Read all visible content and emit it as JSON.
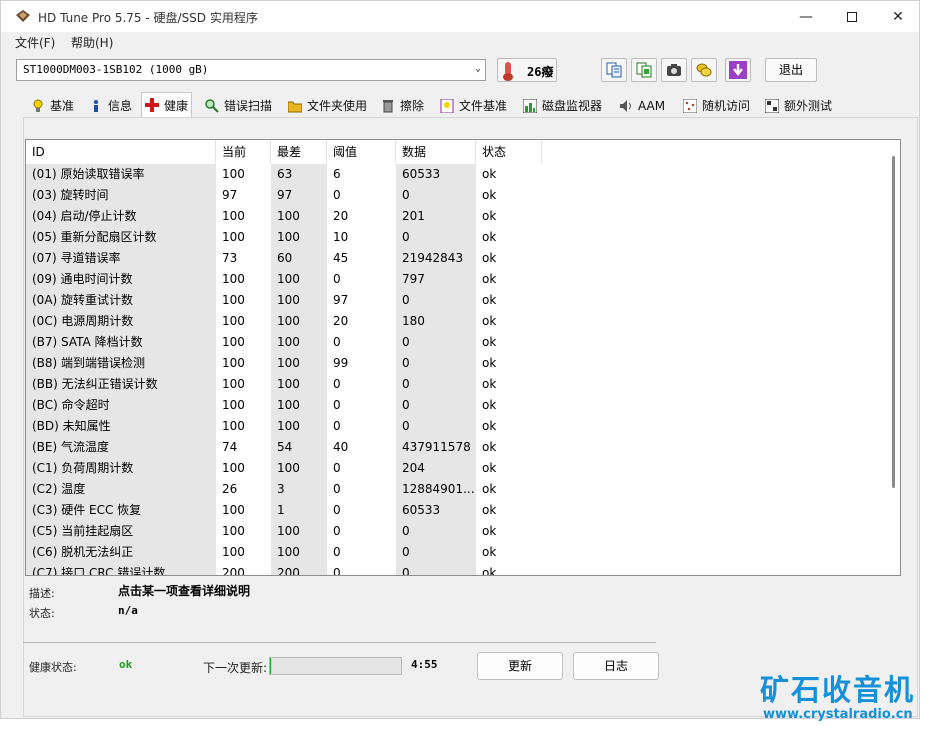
{
  "titlebar": {
    "title": "HD Tune Pro 5.75 - 硬盘/SSD 实用程序",
    "minimize": "—",
    "close": "✕"
  },
  "menu": {
    "file": "文件(F)",
    "help": "帮助(H)"
  },
  "toolbar": {
    "drive": "ST1000DM003-1SB102 (1000 gB)",
    "temperature": "26癈",
    "exit": "退出",
    "icons": [
      "copy-text-icon",
      "copy-screen-icon",
      "camera-icon",
      "coins-icon",
      "download-icon"
    ]
  },
  "tabs": [
    {
      "label": "基准",
      "icon": "bulb-icon"
    },
    {
      "label": "信息",
      "icon": "info-icon"
    },
    {
      "label": "健康",
      "icon": "health-cross-icon",
      "active": true
    },
    {
      "label": "错误扫描",
      "icon": "magnifier-icon"
    },
    {
      "label": "文件夹使用",
      "icon": "folder-icon"
    },
    {
      "label": "擦除",
      "icon": "trash-icon"
    },
    {
      "label": "文件基准",
      "icon": "file-bulb-icon"
    },
    {
      "label": "磁盘监视器",
      "icon": "chart-icon"
    },
    {
      "label": "AAM",
      "icon": "speaker-icon"
    },
    {
      "label": "随机访问",
      "icon": "random-icon"
    },
    {
      "label": "额外测试",
      "icon": "tests-icon"
    }
  ],
  "table": {
    "headers": [
      "ID",
      "当前",
      "最差",
      "阈值",
      "数据",
      "状态"
    ],
    "rows": [
      [
        "(01) 原始读取错误率",
        "100",
        "63",
        "6",
        "60533",
        "ok"
      ],
      [
        "(03) 旋转时间",
        "97",
        "97",
        "0",
        "0",
        "ok"
      ],
      [
        "(04) 启动/停止计数",
        "100",
        "100",
        "20",
        "201",
        "ok"
      ],
      [
        "(05) 重新分配扇区计数",
        "100",
        "100",
        "10",
        "0",
        "ok"
      ],
      [
        "(07) 寻道错误率",
        "73",
        "60",
        "45",
        "21942843",
        "ok"
      ],
      [
        "(09) 通电时间计数",
        "100",
        "100",
        "0",
        "797",
        "ok"
      ],
      [
        "(0A) 旋转重试计数",
        "100",
        "100",
        "97",
        "0",
        "ok"
      ],
      [
        "(0C) 电源周期计数",
        "100",
        "100",
        "20",
        "180",
        "ok"
      ],
      [
        "(B7) SATA 降档计数",
        "100",
        "100",
        "0",
        "0",
        "ok"
      ],
      [
        "(B8) 端到端错误检测",
        "100",
        "100",
        "99",
        "0",
        "ok"
      ],
      [
        "(BB) 无法纠正错误计数",
        "100",
        "100",
        "0",
        "0",
        "ok"
      ],
      [
        "(BC) 命令超时",
        "100",
        "100",
        "0",
        "0",
        "ok"
      ],
      [
        "(BD) 未知属性",
        "100",
        "100",
        "0",
        "0",
        "ok"
      ],
      [
        "(BE) 气流温度",
        "74",
        "54",
        "40",
        "437911578",
        "ok"
      ],
      [
        "(C1) 负荷周期计数",
        "100",
        "100",
        "0",
        "204",
        "ok"
      ],
      [
        "(C2) 温度",
        "26",
        "3",
        "0",
        "12884901...",
        "ok"
      ],
      [
        "(C3) 硬件 ECC 恢复",
        "100",
        "1",
        "0",
        "60533",
        "ok"
      ],
      [
        "(C5) 当前挂起扇区",
        "100",
        "100",
        "0",
        "0",
        "ok"
      ],
      [
        "(C6) 脱机无法纠正",
        "100",
        "100",
        "0",
        "0",
        "ok"
      ],
      [
        "(C7) 接口 CRC 错误计数",
        "200",
        "200",
        "0",
        "0",
        "ok"
      ]
    ]
  },
  "details": {
    "desc_label": "描述:",
    "desc_value": "点击某一项查看详细说明",
    "status_label": "状态:",
    "status_value": "n/a"
  },
  "footer": {
    "health_label": "健康状态:",
    "health_value": "ok",
    "next_update_label": "下一次更新:",
    "progress_fraction": 0.01,
    "timer": "4:55",
    "refresh": "更新",
    "log": "日志"
  },
  "watermark": {
    "name": "矿石收音机",
    "url": "www.crystalradio.cn"
  }
}
